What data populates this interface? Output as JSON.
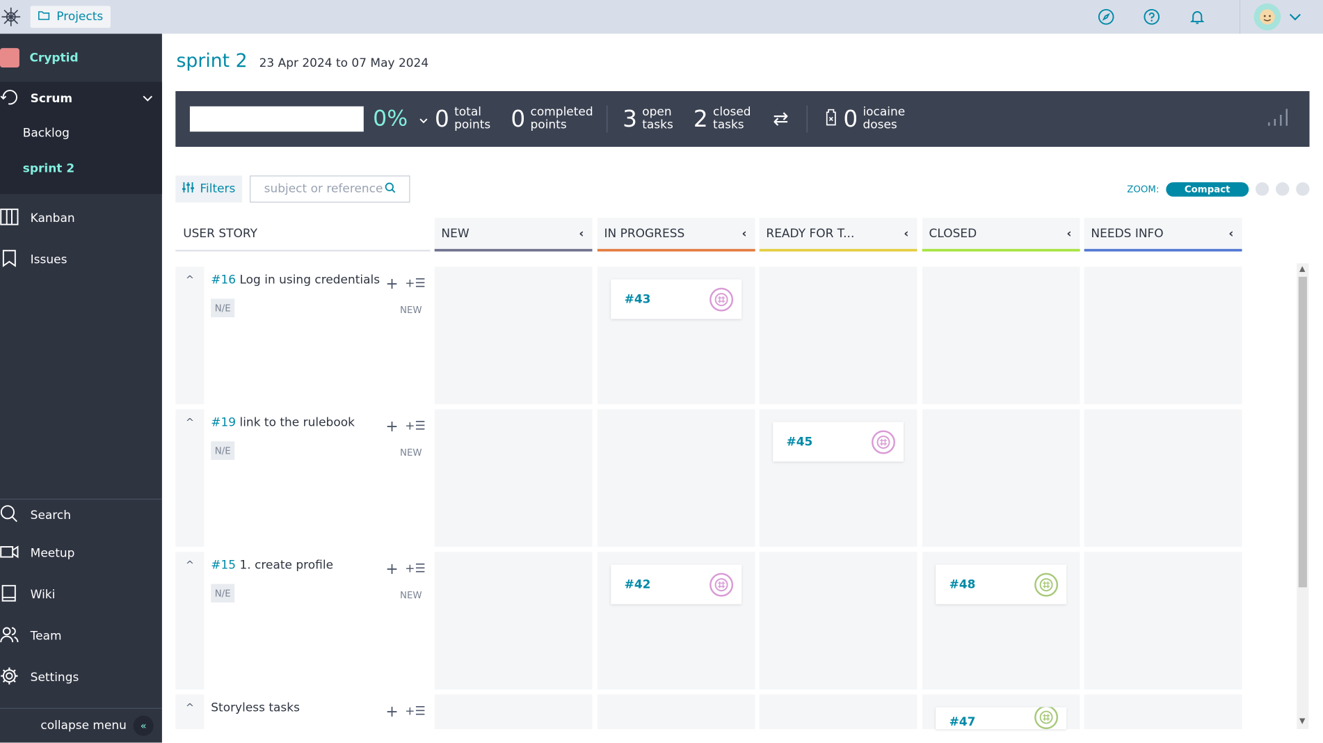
{
  "topbar": {
    "projects_label": "Projects",
    "icons": [
      "logo-icon",
      "folder-icon",
      "compass-icon",
      "help-icon",
      "bell-icon",
      "avatar",
      "chevron-down-icon"
    ]
  },
  "sidebar": {
    "project_name": "Cryptid",
    "scrum_label": "Scrum",
    "backlog_label": "Backlog",
    "sprint_label": "sprint 2",
    "kanban_label": "Kanban",
    "issues_label": "Issues",
    "search_label": "Search",
    "meetup_label": "Meetup",
    "wiki_label": "Wiki",
    "team_label": "Team",
    "settings_label": "Settings",
    "collapse_label": "collapse menu",
    "collapse_glyph": "«"
  },
  "header": {
    "title": "sprint 2",
    "dates": "23 Apr 2024 to 07 May 2024"
  },
  "stats": {
    "progress_pct": "0%",
    "progress_fraction": 0,
    "total_points_num": "0",
    "total_label_1": "total",
    "total_label_2": "points",
    "completed_points_num": "0",
    "completed_label_1": "completed",
    "completed_label_2": "points",
    "open_tasks_num": "3",
    "open_label_1": "open",
    "open_label_2": "tasks",
    "closed_tasks_num": "2",
    "closed_label_1": "closed",
    "closed_label_2": "tasks",
    "iocaine_num": "0",
    "iocaine_label_1": "iocaine",
    "iocaine_label_2": "doses"
  },
  "toolbar": {
    "filters_label": "Filters",
    "search_placeholder": "subject or reference",
    "zoom_label": "ZOOM:",
    "zoom_value": "Compact"
  },
  "columns": {
    "user_story": "USER STORY",
    "list": [
      {
        "label": "NEW",
        "color": "#70728f"
      },
      {
        "label": "IN PROGRESS",
        "color": "#e47c40"
      },
      {
        "label": "READY FOR T...",
        "color": "#e4ce40"
      },
      {
        "label": "CLOSED",
        "color": "#a8e440"
      },
      {
        "label": "NEEDS INFO",
        "color": "#5178d3"
      }
    ]
  },
  "stories": [
    {
      "ref": "#16",
      "title": "Log in using credentials",
      "points": "N/E",
      "status": "NEW"
    },
    {
      "ref": "#19",
      "title": "link to the rulebook",
      "points": "N/E",
      "status": "NEW"
    },
    {
      "ref": "#15",
      "title": "1. create profile",
      "points": "N/E",
      "status": "NEW"
    },
    {
      "ref": "",
      "title": "Storyless tasks",
      "points": "",
      "status": ""
    }
  ],
  "tasks": [
    {
      "ref": "#43",
      "story": 0,
      "column": 1,
      "avatar_color": "#d99ad6"
    },
    {
      "ref": "#45",
      "story": 1,
      "column": 2,
      "avatar_color": "#d99ad6"
    },
    {
      "ref": "#42",
      "story": 2,
      "column": 1,
      "avatar_color": "#d99ad6"
    },
    {
      "ref": "#48",
      "story": 2,
      "column": 3,
      "avatar_color": "#a8c97a"
    },
    {
      "ref": "#47",
      "story": 3,
      "column": 3,
      "avatar_color": "#a8c97a"
    }
  ],
  "glyphs": {
    "plus": "+",
    "add_task": "+☰",
    "collapse": "^",
    "col_collapse": "‹",
    "swap": "⇄",
    "scroll_up": "▲",
    "scroll_down": "▼"
  }
}
